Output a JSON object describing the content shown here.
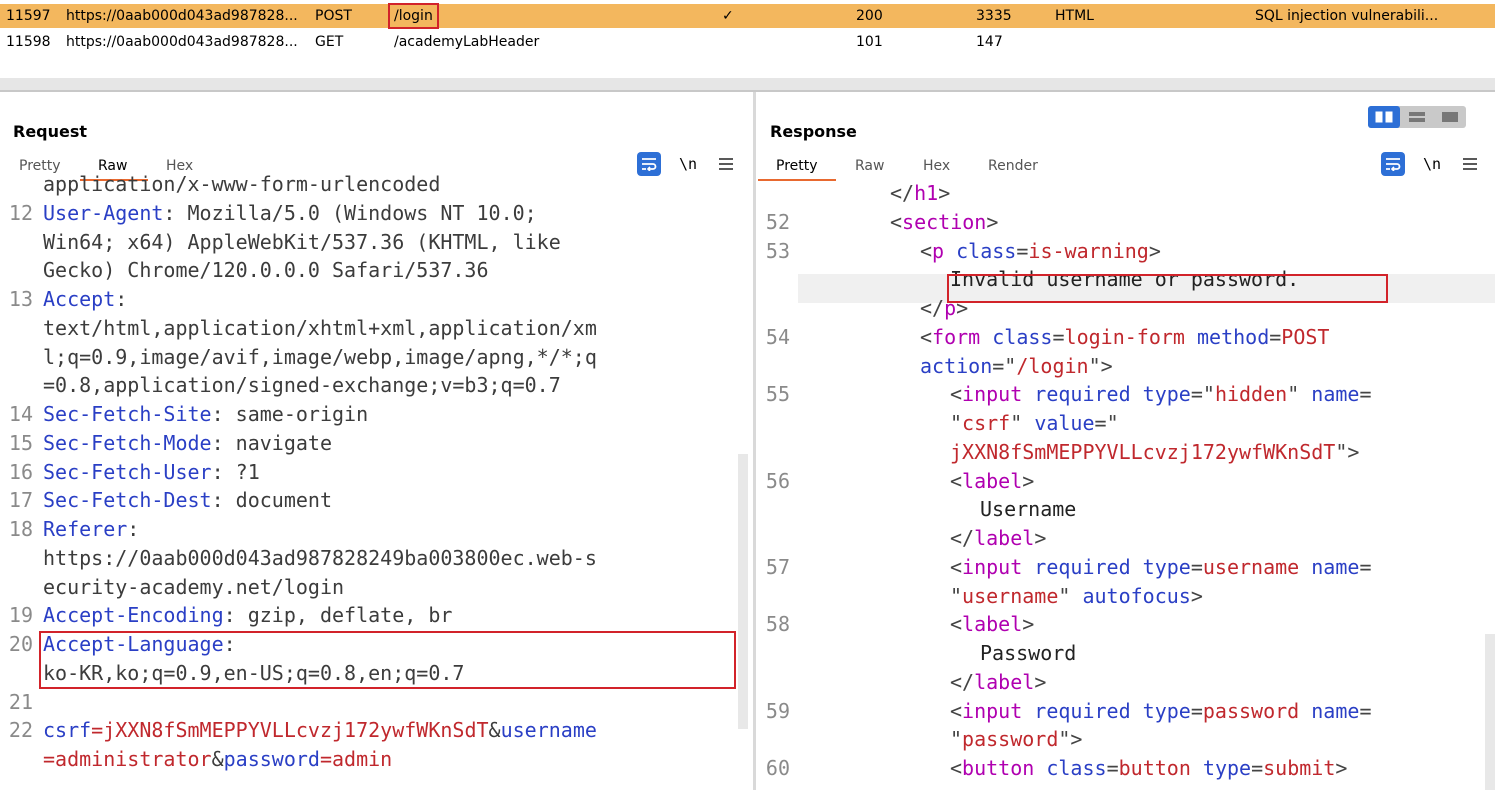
{
  "history": {
    "rows": [
      {
        "id": "11597",
        "host": "https://0aab000d043ad987828...",
        "method": "POST",
        "url": "/login",
        "edited": "✓",
        "status": "200",
        "length": "3335",
        "mime": "HTML",
        "title": "SQL injection vulnerabili..."
      },
      {
        "id": "11598",
        "host": "https://0aab000d043ad987828...",
        "method": "GET",
        "url": "/academyLabHeader",
        "edited": "",
        "status": "101",
        "length": "147",
        "mime": "",
        "title": ""
      }
    ]
  },
  "request": {
    "title": "Request",
    "tabs": [
      "Pretty",
      "Raw",
      "Hex"
    ],
    "active_tab": "Raw",
    "newline_label": "\\n",
    "lines": [
      {
        "n": "",
        "parts": [
          {
            "t": "application/x-www-form-urlencoded",
            "c": "vv"
          }
        ]
      },
      {
        "n": "12",
        "parts": [
          {
            "t": "User-Agent",
            "c": "kk"
          },
          {
            "t": ": Mozilla/5.0 (Windows NT 10.0;",
            "c": "vv"
          }
        ]
      },
      {
        "n": "",
        "parts": [
          {
            "t": "Win64; x64) AppleWebKit/537.36 (KHTML, like",
            "c": "vv"
          }
        ]
      },
      {
        "n": "",
        "parts": [
          {
            "t": "Gecko) Chrome/120.0.0.0 Safari/537.36",
            "c": "vv"
          }
        ]
      },
      {
        "n": "13",
        "parts": [
          {
            "t": "Accept",
            "c": "kk"
          },
          {
            "t": ":",
            "c": "vv"
          }
        ]
      },
      {
        "n": "",
        "parts": [
          {
            "t": "text/html,application/xhtml+xml,application/xm",
            "c": "vv"
          }
        ]
      },
      {
        "n": "",
        "parts": [
          {
            "t": "l;q=0.9,image/avif,image/webp,image/apng,*/*;q",
            "c": "vv"
          }
        ]
      },
      {
        "n": "",
        "parts": [
          {
            "t": "=0.8,application/signed-exchange;v=b3;q=0.7",
            "c": "vv"
          }
        ]
      },
      {
        "n": "14",
        "parts": [
          {
            "t": "Sec-Fetch-Site",
            "c": "kk"
          },
          {
            "t": ": same-origin",
            "c": "vv"
          }
        ]
      },
      {
        "n": "15",
        "parts": [
          {
            "t": "Sec-Fetch-Mode",
            "c": "kk"
          },
          {
            "t": ": navigate",
            "c": "vv"
          }
        ]
      },
      {
        "n": "16",
        "parts": [
          {
            "t": "Sec-Fetch-User",
            "c": "kk"
          },
          {
            "t": ": ?1",
            "c": "vv"
          }
        ]
      },
      {
        "n": "17",
        "parts": [
          {
            "t": "Sec-Fetch-Dest",
            "c": "kk"
          },
          {
            "t": ": document",
            "c": "vv"
          }
        ]
      },
      {
        "n": "18",
        "parts": [
          {
            "t": "Referer",
            "c": "kk"
          },
          {
            "t": ":",
            "c": "vv"
          }
        ]
      },
      {
        "n": "",
        "parts": [
          {
            "t": "https://0aab000d043ad987828249ba003800ec.web-s",
            "c": "vv"
          }
        ]
      },
      {
        "n": "",
        "parts": [
          {
            "t": "ecurity-academy.net/login",
            "c": "vv"
          }
        ]
      },
      {
        "n": "19",
        "parts": [
          {
            "t": "Accept-Encoding",
            "c": "kk"
          },
          {
            "t": ": gzip, deflate, br",
            "c": "vv"
          }
        ]
      },
      {
        "n": "20",
        "parts": [
          {
            "t": "Accept-Language",
            "c": "kk"
          },
          {
            "t": ":",
            "c": "vv"
          }
        ]
      },
      {
        "n": "",
        "parts": [
          {
            "t": "ko-KR,ko;q=0.9,en-US;q=0.8,en;q=0.7",
            "c": "vv"
          }
        ]
      },
      {
        "n": "21",
        "parts": []
      },
      {
        "n": "22",
        "parts": [
          {
            "t": "csrf",
            "c": "kk"
          },
          {
            "t": "=jXXN8fSmMEPPYVLLcvzj172ywfWKnSdT",
            "c": "br"
          },
          {
            "t": "&",
            "c": "vv"
          },
          {
            "t": "username",
            "c": "kk"
          }
        ]
      },
      {
        "n": "",
        "parts": [
          {
            "t": "=administrator",
            "c": "br"
          },
          {
            "t": "&",
            "c": "vv"
          },
          {
            "t": "password",
            "c": "kk"
          },
          {
            "t": "=admin",
            "c": "br"
          }
        ]
      }
    ]
  },
  "response": {
    "title": "Response",
    "tabs": [
      "Pretty",
      "Raw",
      "Hex",
      "Render"
    ],
    "active_tab": "Pretty",
    "newline_label": "\\n",
    "lines": [
      {
        "n": "",
        "indent": 3,
        "parts": [
          {
            "t": "</",
            "c": "gt"
          },
          {
            "t": "h1",
            "c": "tg"
          },
          {
            "t": ">",
            "c": "gt"
          }
        ]
      },
      {
        "n": "52",
        "indent": 3,
        "parts": [
          {
            "t": "<",
            "c": "gt"
          },
          {
            "t": "section",
            "c": "tg"
          },
          {
            "t": ">",
            "c": "gt"
          }
        ]
      },
      {
        "n": "53",
        "indent": 4,
        "parts": [
          {
            "t": "<",
            "c": "gt"
          },
          {
            "t": "p ",
            "c": "tg"
          },
          {
            "t": "class",
            "c": "at"
          },
          {
            "t": "=",
            "c": "gt"
          },
          {
            "t": "is-warning",
            "c": "sv"
          },
          {
            "t": ">",
            "c": "gt"
          }
        ]
      },
      {
        "n": "",
        "indent": 5,
        "parts": [
          {
            "t": "Invalid username or password.",
            "c": "tx"
          }
        ]
      },
      {
        "n": "",
        "indent": 4,
        "parts": [
          {
            "t": "</",
            "c": "gt"
          },
          {
            "t": "p",
            "c": "tg"
          },
          {
            "t": ">",
            "c": "gt"
          }
        ]
      },
      {
        "n": "54",
        "indent": 4,
        "parts": [
          {
            "t": "<",
            "c": "gt"
          },
          {
            "t": "form ",
            "c": "tg"
          },
          {
            "t": "class",
            "c": "at"
          },
          {
            "t": "=",
            "c": "gt"
          },
          {
            "t": "login-form ",
            "c": "sv"
          },
          {
            "t": "method",
            "c": "at"
          },
          {
            "t": "=",
            "c": "gt"
          },
          {
            "t": "POST",
            "c": "sv"
          }
        ]
      },
      {
        "n": "",
        "indent": 4,
        "parts": [
          {
            "t": "action",
            "c": "at"
          },
          {
            "t": "=\"",
            "c": "gt"
          },
          {
            "t": "/login",
            "c": "sv"
          },
          {
            "t": "\">",
            "c": "gt"
          }
        ]
      },
      {
        "n": "55",
        "indent": 5,
        "parts": [
          {
            "t": "<",
            "c": "gt"
          },
          {
            "t": "input ",
            "c": "tg"
          },
          {
            "t": "required ",
            "c": "at"
          },
          {
            "t": "type",
            "c": "at"
          },
          {
            "t": "=\"",
            "c": "gt"
          },
          {
            "t": "hidden",
            "c": "sv"
          },
          {
            "t": "\" ",
            "c": "gt"
          },
          {
            "t": "name",
            "c": "at"
          },
          {
            "t": "=",
            "c": "gt"
          }
        ]
      },
      {
        "n": "",
        "indent": 5,
        "parts": [
          {
            "t": "\"",
            "c": "gt"
          },
          {
            "t": "csrf",
            "c": "sv"
          },
          {
            "t": "\" ",
            "c": "gt"
          },
          {
            "t": "value",
            "c": "at"
          },
          {
            "t": "=\"",
            "c": "gt"
          }
        ]
      },
      {
        "n": "",
        "indent": 5,
        "parts": [
          {
            "t": "jXXN8fSmMEPPYVLLcvzj172ywfWKnSdT",
            "c": "sv"
          },
          {
            "t": "\">",
            "c": "gt"
          }
        ]
      },
      {
        "n": "56",
        "indent": 5,
        "parts": [
          {
            "t": "<",
            "c": "gt"
          },
          {
            "t": "label",
            "c": "tg"
          },
          {
            "t": ">",
            "c": "gt"
          }
        ]
      },
      {
        "n": "",
        "indent": 6,
        "parts": [
          {
            "t": "Username",
            "c": "tx"
          }
        ]
      },
      {
        "n": "",
        "indent": 5,
        "parts": [
          {
            "t": "</",
            "c": "gt"
          },
          {
            "t": "label",
            "c": "tg"
          },
          {
            "t": ">",
            "c": "gt"
          }
        ]
      },
      {
        "n": "57",
        "indent": 5,
        "parts": [
          {
            "t": "<",
            "c": "gt"
          },
          {
            "t": "input ",
            "c": "tg"
          },
          {
            "t": "required ",
            "c": "at"
          },
          {
            "t": "type",
            "c": "at"
          },
          {
            "t": "=",
            "c": "gt"
          },
          {
            "t": "username ",
            "c": "sv"
          },
          {
            "t": "name",
            "c": "at"
          },
          {
            "t": "=",
            "c": "gt"
          }
        ]
      },
      {
        "n": "",
        "indent": 5,
        "parts": [
          {
            "t": "\"",
            "c": "gt"
          },
          {
            "t": "username",
            "c": "sv"
          },
          {
            "t": "\" ",
            "c": "gt"
          },
          {
            "t": "autofocus",
            "c": "at"
          },
          {
            "t": ">",
            "c": "gt"
          }
        ]
      },
      {
        "n": "58",
        "indent": 5,
        "parts": [
          {
            "t": "<",
            "c": "gt"
          },
          {
            "t": "label",
            "c": "tg"
          },
          {
            "t": ">",
            "c": "gt"
          }
        ]
      },
      {
        "n": "",
        "indent": 6,
        "parts": [
          {
            "t": "Password",
            "c": "tx"
          }
        ]
      },
      {
        "n": "",
        "indent": 5,
        "parts": [
          {
            "t": "</",
            "c": "gt"
          },
          {
            "t": "label",
            "c": "tg"
          },
          {
            "t": ">",
            "c": "gt"
          }
        ]
      },
      {
        "n": "59",
        "indent": 5,
        "parts": [
          {
            "t": "<",
            "c": "gt"
          },
          {
            "t": "input ",
            "c": "tg"
          },
          {
            "t": "required ",
            "c": "at"
          },
          {
            "t": "type",
            "c": "at"
          },
          {
            "t": "=",
            "c": "gt"
          },
          {
            "t": "password ",
            "c": "sv"
          },
          {
            "t": "name",
            "c": "at"
          },
          {
            "t": "=",
            "c": "gt"
          }
        ]
      },
      {
        "n": "",
        "indent": 5,
        "parts": [
          {
            "t": "\"",
            "c": "gt"
          },
          {
            "t": "password",
            "c": "sv"
          },
          {
            "t": "\">",
            "c": "gt"
          }
        ]
      },
      {
        "n": "60",
        "indent": 5,
        "parts": [
          {
            "t": "<",
            "c": "gt"
          },
          {
            "t": "button ",
            "c": "tg"
          },
          {
            "t": "class",
            "c": "at"
          },
          {
            "t": "=",
            "c": "gt"
          },
          {
            "t": "button ",
            "c": "sv"
          },
          {
            "t": "type",
            "c": "at"
          },
          {
            "t": "=",
            "c": "gt"
          },
          {
            "t": "submit",
            "c": "sv"
          },
          {
            "t": ">",
            "c": "gt"
          }
        ]
      }
    ]
  },
  "colors": {
    "selected_row": "#f3b75e",
    "highlight_box": "#d2232a",
    "accent": "#2d6fd6",
    "tab_underline": "#e8692f"
  },
  "icons": {
    "wrap": "wrap-lines-icon",
    "menu": "hamburger-menu-icon",
    "layout": [
      "split-horizontal-icon",
      "split-vertical-icon",
      "single-pane-icon"
    ]
  }
}
